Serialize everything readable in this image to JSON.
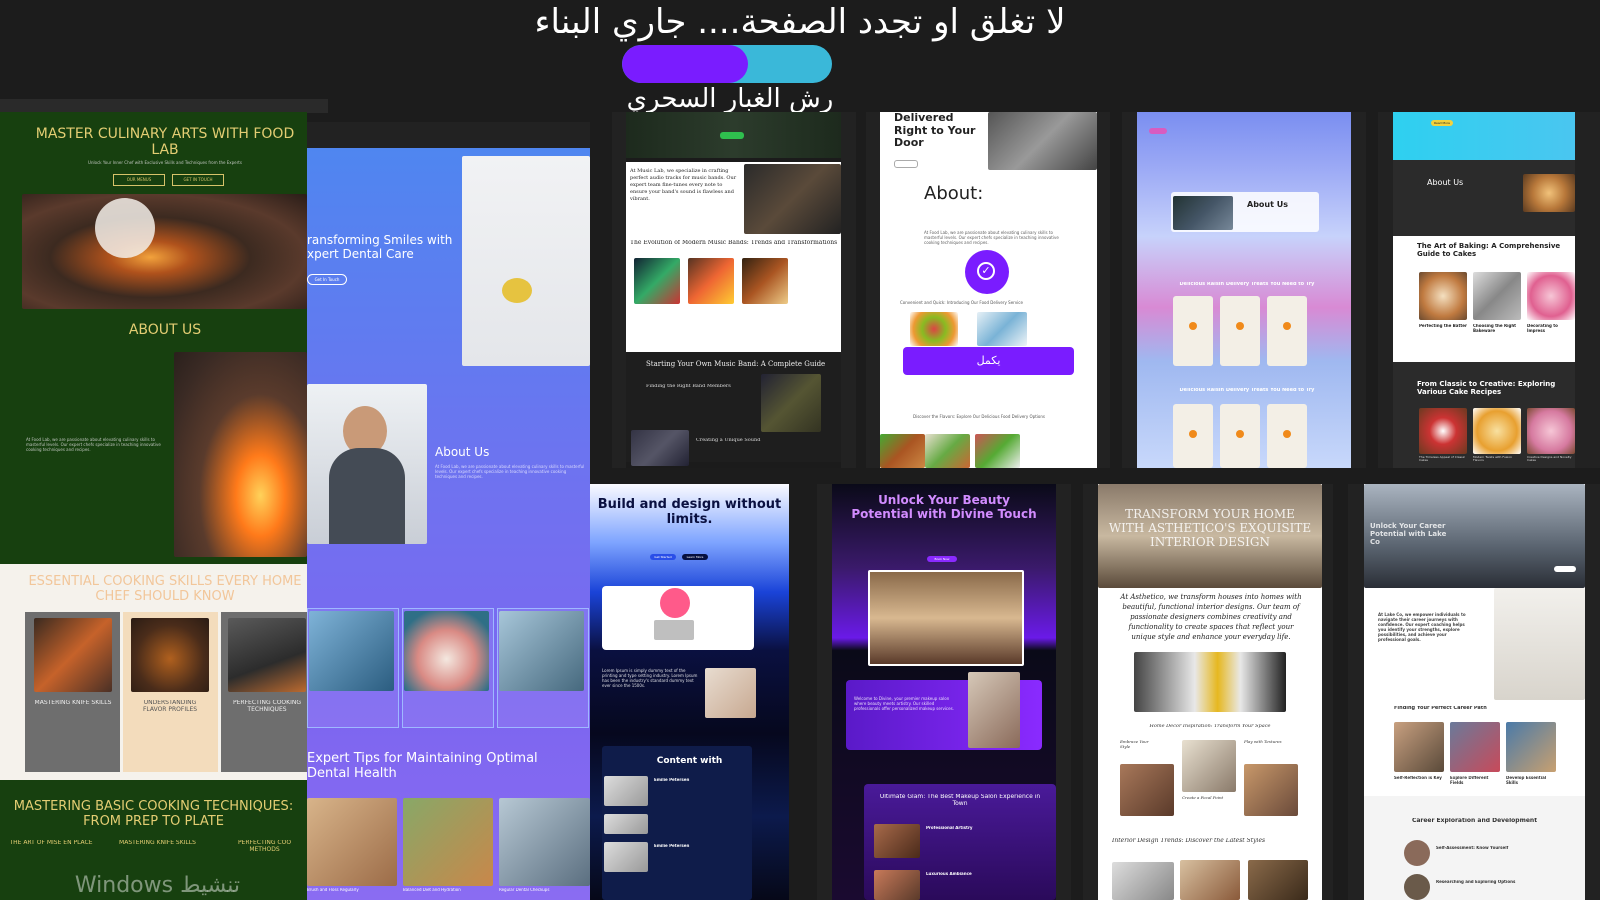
{
  "header": {
    "title": "لا تغلق او تجدد الصفحة.... جاري البناء",
    "subtitle": "رش الغبار السحري",
    "progress": 0.6,
    "progress_colors": {
      "fill": "#7a1cff",
      "track": "#3ab8d9"
    }
  },
  "watermark": "تنشيط Windows",
  "cards": {
    "culinary": {
      "hero_title": "MASTER CULINARY ARTS WITH FOOD LAB",
      "hero_sub": "Unlock Your Inner Chef with Exclusive Skills and Techniques from the Experts",
      "btn1": "OUR MENUS",
      "btn2": "GET IN TOUCH",
      "about_title": "ABOUT US",
      "about_text": "At Food Lab, we are passionate about elevating culinary skills to masterful levels. Our expert chefs specialize in teaching innovative cooking techniques and recipes.",
      "skills_title": "ESSENTIAL COOKING SKILLS EVERY HOME CHEF SHOULD KNOW",
      "skill1": "MASTERING KNIFE SKILLS",
      "skill2": "UNDERSTANDING FLAVOR PROFILES",
      "skill3": "PERFECTING COOKING TECHNIQUES",
      "basics_title": "MASTERING BASIC COOKING TECHNIQUES: FROM PREP TO PLATE",
      "basic1": "THE ART OF MISE EN PLACE",
      "basic2": "MASTERING KNIFE SKILLS",
      "basic3": "PERFECTING COO METHODS"
    },
    "dental": {
      "hero_title": "ransforming Smiles with xpert Dental Care",
      "hero_btn": "Get In Touch",
      "about_title": "About Us",
      "tips_title": "Expert Tips for Maintaining Optimal Dental Health",
      "cap1": "Brush and Floss Regularly",
      "cap2": "Balanced Diet and Hydration",
      "cap3": "Regular Dental Checkups"
    },
    "music": {
      "intro": "At Music Lab, we specialize in crafting perfect audio tracks for music bands. Our expert team fine-tunes every note to ensure your band's sound is flawless and vibrant.",
      "evolution_title": "The Evolution of Modern Music Bands: Trends and Transformations",
      "start_title": "Starting Your Own Music Band: A Complete Guide",
      "members_title": "Finding the Right Band Members",
      "sound_title": "Creating a Unique Sound"
    },
    "delivery": {
      "hero_title": "Delivered Right to Your Door",
      "about_title": "About:",
      "tagline": "Convenient and Quick: Introducing Our Food Delivery Service",
      "continue_btn": "يكمل",
      "footer_line": "Discover the Flavors: Explore Our Delicious Food Delivery Options"
    },
    "raisin": {
      "about_title": "About Us",
      "section1": "Delicious Raisin Delivery Treats You Need to Try",
      "section2": "Delicious Raisin Delivery Treats You Need to Try"
    },
    "baking": {
      "badge": "Read More",
      "about_title": "About Us",
      "guide_title": "The Art of Baking: A Comprehensive Guide to Cakes",
      "g1": "Perfecting the Batter",
      "g2": "Choosing the Right Bakeware",
      "g3": "Decorating to Impress",
      "classic_title": "From Classic to Creative: Exploring Various Cake Recipes",
      "c1": "The Timeless Appeal of Classic Cakes",
      "c2": "Modern Twists with Fusion Flavors",
      "c3": "Creative Designs and Novelty Cakes"
    },
    "design": {
      "hero_title": "Build and design without limits.",
      "btn1": "Get Started",
      "btn2": "Learn More",
      "lorem": "Lorem Ipsum is simply dummy text of the printing and type setting industry. Lorem Ipsum has been the industry's standard dummy text ever since the 1500s.",
      "content_title": "Content with",
      "person": "Emilie Petersen"
    },
    "beauty": {
      "hero_title": "Unlock Your Beauty Potential with Divine Touch",
      "cta": "Book Now",
      "welcome": "Welcome to Divine, your premier makeup salon where beauty meets artistry. Our skilled professionals offer personalized makeup services.",
      "glam_title": "Ultimate Glam: The Best Makeup Salon Experience in Town",
      "item1": "Professional Artistry",
      "item2": "Luxurious Ambiance"
    },
    "interior": {
      "hero_title": "TRANSFORM YOUR HOME WITH ASTHETICO'S EXQUISITE INTERIOR DESIGN",
      "intro": "At Asthetico, we transform houses into homes with beautiful, functional interior designs. Our team of passionate designers combines creativity and functionality to create spaces that reflect your unique style and enhance your everyday life.",
      "inspo_title": "Home Decor Inspiration: Transform Your Space",
      "i1": "Embrace Your Style",
      "i2": "Create a Focal Point",
      "i3": "Play with Textures",
      "trends_title": "Interior Design Trends: Discover the Latest Styles"
    },
    "career": {
      "hero_title": "Unlock Your Career Potential with Lake Co",
      "intro": "At Lake Co, we empower individuals to navigate their career journeys with confidence. Our expert coaching helps you identify your strengths, explore possibilities, and achieve your professional goals.",
      "path_title": "Finding Your Perfect Career Path",
      "p1": "Self-Reflection is Key",
      "p2": "Explore Different Fields",
      "p3": "Develop Essential Skills",
      "dev_title": "Career Exploration and Development",
      "d1": "Self-Assessment: Know Yourself",
      "d2": "Researching and Exploring Options"
    }
  }
}
